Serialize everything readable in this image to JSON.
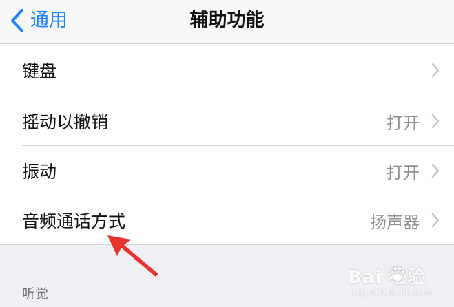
{
  "nav": {
    "back_label": "通用",
    "title": "辅助功能"
  },
  "rows": [
    {
      "label": "键盘",
      "value": ""
    },
    {
      "label": "摇动以撤销",
      "value": "打开"
    },
    {
      "label": "振动",
      "value": "打开"
    },
    {
      "label": "音频通话方式",
      "value": "扬声器"
    }
  ],
  "section": {
    "header": "听觉"
  },
  "watermark": {
    "brand": "Bai  经验",
    "url": "jingyan.baidu.com"
  },
  "colors": {
    "accent": "#1a82fb",
    "annotation_arrow": "#e8322e"
  }
}
